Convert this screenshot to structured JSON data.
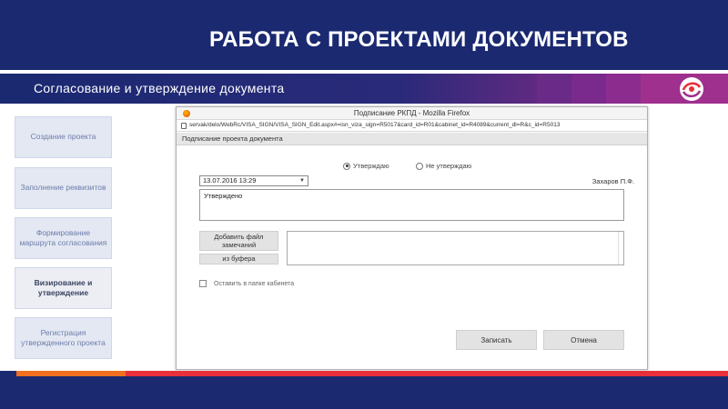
{
  "slide": {
    "title": "РАБОТА С ПРОЕКТАМИ ДОКУМЕНТОВ",
    "subtitle": "Согласование и утверждение документа"
  },
  "steps": [
    {
      "label": "Создание проекта",
      "active": false
    },
    {
      "label": "Заполнение реквизитов",
      "active": false
    },
    {
      "label": "Формирование маршрута согласования",
      "active": false
    },
    {
      "label": "Визирование и утверждение",
      "active": true
    },
    {
      "label": "Регистрация утвержденного проекта",
      "active": false
    }
  ],
  "window": {
    "title": "Подписание РКПД - Mozilla Firefox",
    "url": "servak/delo/WebRc/VISA_SIGN/VISA_SIGN_Edit.aspx#=isn_viza_sign=R5017&card_id=R01&cabinet_id=R4089&current_dl=R&c_id=R5013",
    "dialog_header": "Подписание проекта документа",
    "radio_approve": "Утверждаю",
    "radio_reject": "Не утверждаю",
    "date_value": "13.07.2016 13:29",
    "signer": "Захаров П.Ф.",
    "comment_value": "Утверждено",
    "add_file_label": "Добавить файл замечаний",
    "from_buffer_label": "из буфера",
    "keep_in_folder_label": "Оставить в папке кабинета",
    "save_label": "Записать",
    "cancel_label": "Отмена"
  },
  "colors": {
    "banner": "#1a2970",
    "accent_magenta": "#a0308e",
    "accent_orange": "#f07020",
    "accent_red": "#e8303a"
  },
  "icons": [
    "firefox-icon",
    "lock-icon",
    "chevron-down-icon",
    "logo-icon"
  ]
}
